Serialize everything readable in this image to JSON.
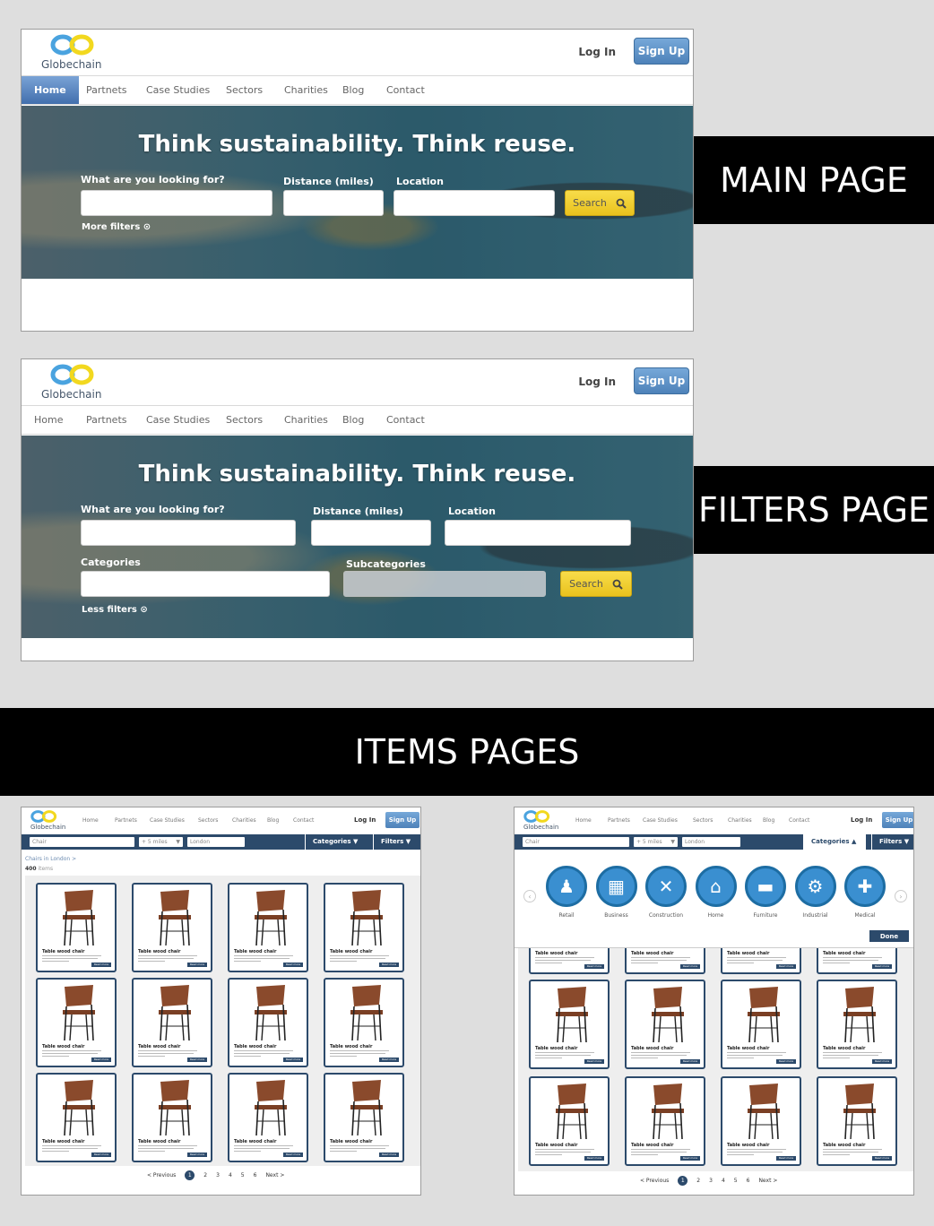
{
  "main": {
    "logo_text": "Globechain",
    "login": "Log In",
    "signup": "Sign Up",
    "nav": [
      "Home",
      "Partnets",
      "Case Studies",
      "Sectors",
      "Charities",
      "Blog",
      "Contact"
    ],
    "hero_title": "Think sustainability. Think reuse.",
    "label_what": "What are you looking for?",
    "label_distance": "Distance (miles)",
    "label_location": "Location",
    "search": "Search",
    "more_filters": "More filters",
    "side_label": "MAIN PAGE"
  },
  "filters": {
    "logo_text": "Globechain",
    "login": "Log In",
    "signup": "Sign Up",
    "nav": [
      "Home",
      "Partnets",
      "Case Studies",
      "Sectors",
      "Charities",
      "Blog",
      "Contact"
    ],
    "hero_title": "Think sustainability. Think reuse.",
    "label_what": "What are you looking for?",
    "label_distance": "Distance (miles)",
    "label_location": "Location",
    "label_categories": "Categories",
    "label_subcategories": "Subcategories",
    "search": "Search",
    "less_filters": "Less filters",
    "side_label": "FILTERS PAGE"
  },
  "items_banner": "ITEMS PAGES",
  "items_page": {
    "logo_text": "Globechain",
    "nav": [
      "Home",
      "Partnets",
      "Case Studies",
      "Sectors",
      "Charities",
      "Blog",
      "Contact"
    ],
    "login": "Log In",
    "signup": "Sign Up",
    "search_value": "Chair",
    "distance_value": "+ 5 miles",
    "location_value": "London",
    "categories": "Categories",
    "filters": "Filters",
    "breadcrumb": "Chairs in London  >",
    "count": "400",
    "count_suffix": "items",
    "card_title": "Table wood chair",
    "read_more": "Read more",
    "pager_prev": "< Previous",
    "pager_next": "Next >",
    "pages": [
      "1",
      "2",
      "3",
      "4",
      "5",
      "6"
    ]
  },
  "category_panel": {
    "items": [
      {
        "label": "Retail",
        "icon": "mannequin-icon",
        "glyph": "♟"
      },
      {
        "label": "Business",
        "icon": "office-icon",
        "glyph": "▦"
      },
      {
        "label": "Construction",
        "icon": "tools-icon",
        "glyph": "✕"
      },
      {
        "label": "Home",
        "icon": "house-icon",
        "glyph": "⌂"
      },
      {
        "label": "Furniture",
        "icon": "sofa-icon",
        "glyph": "▬"
      },
      {
        "label": "Industrial",
        "icon": "forklift-icon",
        "glyph": "⚙"
      },
      {
        "label": "Medical",
        "icon": "hospital-icon",
        "glyph": "✚"
      }
    ],
    "done": "Done"
  },
  "colors": {
    "brand_blue": "#2c4a6b",
    "signup_blue": "#4e82b9",
    "search_yellow": "#f0cc2e"
  }
}
